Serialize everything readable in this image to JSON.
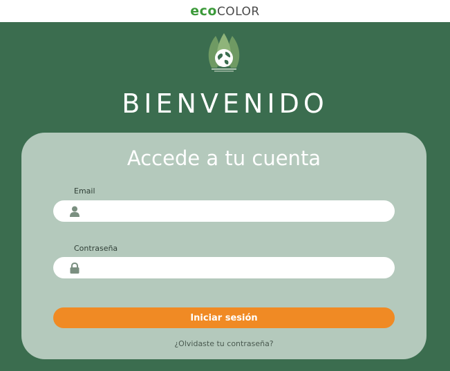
{
  "brand": {
    "logo_part1": "eco",
    "logo_part2": "COLOR"
  },
  "header": {
    "title": "BIENVENIDO"
  },
  "login": {
    "title": "Accede a tu cuenta",
    "email_label": "Email",
    "email_value": "",
    "password_label": "Contraseña",
    "password_value": "",
    "submit_label": "Iniciar sesión",
    "forgot_label": "¿Olvidaste tu contraseña?"
  },
  "colors": {
    "background": "#3b6d4f",
    "card": "#b4c9bc",
    "button": "#f08a24",
    "logo_green": "#3c9a3a"
  },
  "icons": {
    "emblem": "globe-leaves-icon",
    "email": "user-icon",
    "password": "lock-icon"
  }
}
